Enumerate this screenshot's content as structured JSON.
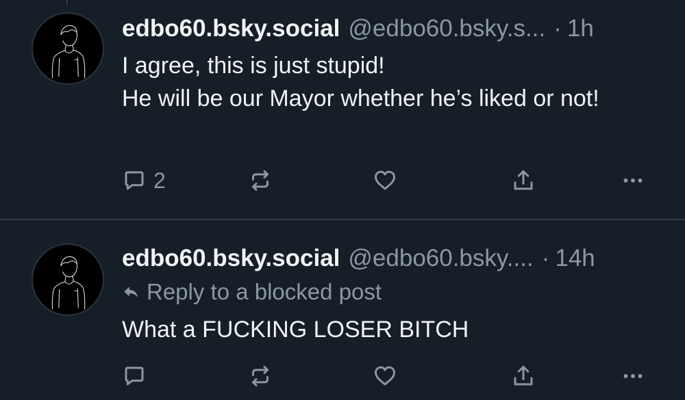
{
  "posts": [
    {
      "display_name": "edbo60.bsky.social",
      "handle": "@edbo60.bsky.s...",
      "separator": "·",
      "time": "1h",
      "text": "I agree, this is just stupid!\nHe will be our Mayor whether he’s liked or not!",
      "reply_count": "2"
    },
    {
      "display_name": "edbo60.bsky.social",
      "handle": "@edbo60.bsky....",
      "separator": "·",
      "time": "14h",
      "reply_note": "Reply to a blocked post",
      "text": "What a FUCKING LOSER BITCH",
      "reply_count": ""
    }
  ],
  "icons": {
    "reply": "speech-bubble-icon",
    "repost": "repost-arrows-icon",
    "like": "heart-icon",
    "share": "share-upload-icon",
    "more": "ellipsis-icon",
    "reply_note": "reply-arrow-icon"
  },
  "colors": {
    "background": "#161e27",
    "text": "#f1f3f5",
    "muted": "#8b98a5",
    "divider": "#2e3b49"
  }
}
